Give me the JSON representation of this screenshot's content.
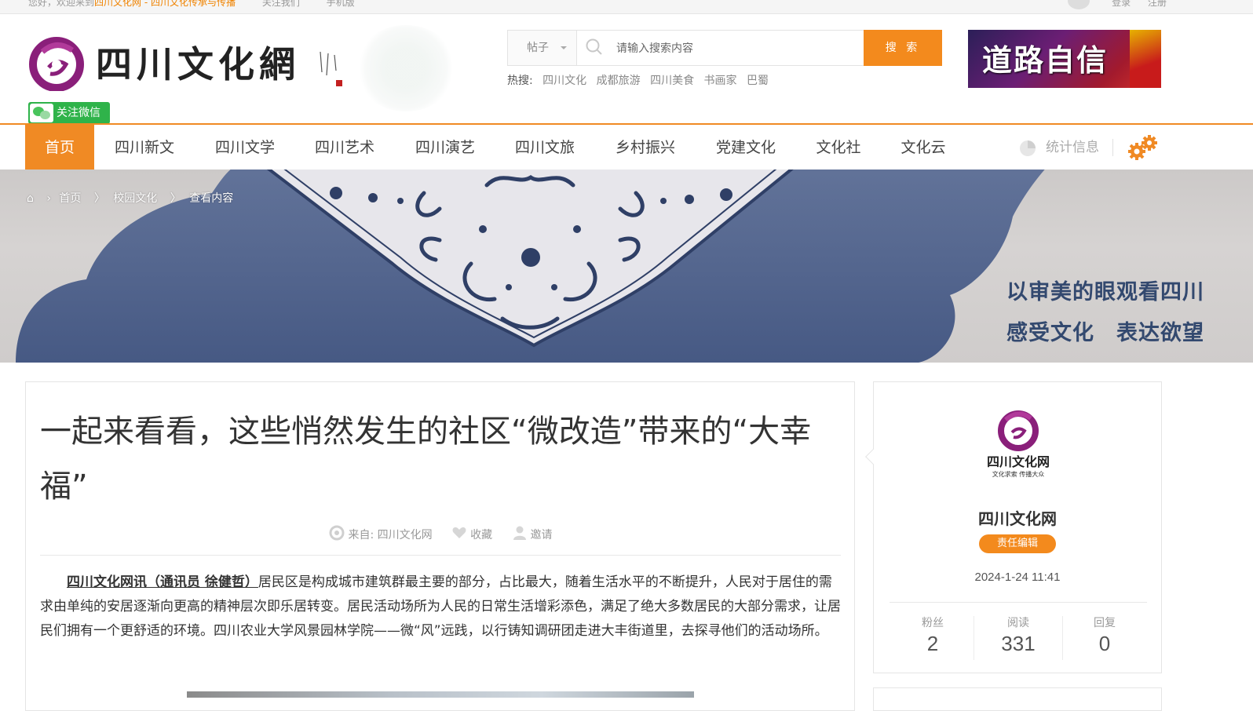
{
  "topbar": {
    "crumb_prefix": "您好，欢迎来到",
    "crumb_highlight": "四川文化网 - 四川文化传承与传播",
    "links": [
      "关注我们",
      "手机版"
    ],
    "login": "登录",
    "register": "注册"
  },
  "header": {
    "logo_text": "四川文化網",
    "wechat_label": "关注微信",
    "search": {
      "type_label": "帖子",
      "placeholder": "请输入搜索内容",
      "button_label": "搜 索"
    },
    "hot_label": "热搜:",
    "hot_terms": [
      "四川文化",
      "成都旅游",
      "四川美食",
      "书画家",
      "巴蜀"
    ],
    "ad_text": "道路自信"
  },
  "nav": {
    "items": [
      "首页",
      "四川新文",
      "四川文学",
      "四川艺术",
      "四川演艺",
      "四川文旅",
      "乡村振兴",
      "党建文化",
      "文化社",
      "文化云"
    ],
    "active_index": 0,
    "stat_label": "统计信息"
  },
  "banner": {
    "breadcrumbs": [
      "首页",
      "校园文化",
      "查看内容"
    ],
    "slogan_line1": "以审美的眼观看四川",
    "slogan_line2": "感受文化　表达欲望"
  },
  "article": {
    "title": "一起来看看，这些悄然发生的社区“微改造”带来的“大幸福”",
    "source": "来自: 四川文化网",
    "favorite_label": "收藏",
    "invite_label": "邀请",
    "lead": "四川文化网讯（通讯员 徐健哲）",
    "body": "居民区是构成城市建筑群最主要的部分，占比最大，随着生活水平的不断提升，人民对于居住的需求由单纯的安居逐渐向更高的精神层次即乐居转变。居民活动场所为人民的日常生活增彩添色，满足了绝大多数居民的大部分需求，让居民们拥有一个更舒适的环境。四川农业大学风景园林学院——微“风”远践，以行铸知调研团走进大丰街道里，去探寻他们的活动场所。"
  },
  "author": {
    "logo_name": "四川文化网",
    "logo_tagline": "文化求索 传播大众",
    "name": "四川文化网",
    "badge": "责任编辑",
    "date": "2024-1-24 11:41",
    "stats": [
      {
        "label": "粉丝",
        "value": "2"
      },
      {
        "label": "阅读",
        "value": "331"
      },
      {
        "label": "回复",
        "value": "0"
      }
    ]
  },
  "colors": {
    "accent": "#f08a24",
    "logo_purple": "#8a1f7a",
    "slogan_blue": "#33496f",
    "wechat_green": "#2fb34a"
  }
}
